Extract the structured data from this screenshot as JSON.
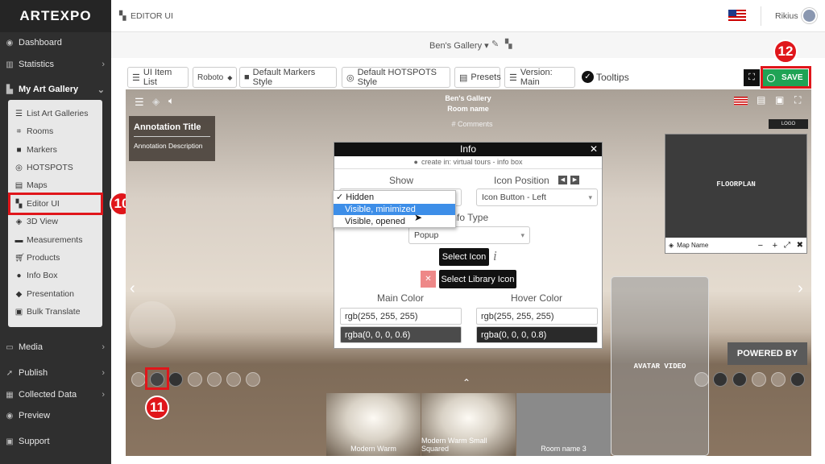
{
  "brand": {
    "logo": "ARTEXPO"
  },
  "sidebar": {
    "items": [
      {
        "label": "Dashboard",
        "icon": "dashboard-icon"
      },
      {
        "label": "Statistics",
        "icon": "statistics-icon"
      },
      {
        "label": "My Art Gallery",
        "icon": "gallery-icon"
      },
      {
        "label": "Media",
        "icon": "media-icon"
      },
      {
        "label": "Publish",
        "icon": "publish-icon"
      },
      {
        "label": "Collected Data",
        "icon": "data-icon"
      },
      {
        "label": "Preview",
        "icon": "eye-icon"
      },
      {
        "label": "Support",
        "icon": "support-icon"
      }
    ],
    "submenu": [
      {
        "label": "List Art Galleries"
      },
      {
        "label": "Rooms"
      },
      {
        "label": "Markers"
      },
      {
        "label": "HOTSPOTS"
      },
      {
        "label": "Maps"
      },
      {
        "label": "Editor UI"
      },
      {
        "label": "3D View"
      },
      {
        "label": "Measurements"
      },
      {
        "label": "Products"
      },
      {
        "label": "Info Box"
      },
      {
        "label": "Presentation"
      },
      {
        "label": "Bulk Translate"
      }
    ]
  },
  "header": {
    "page_title": "EDITOR UI",
    "user": "Rikius",
    "gallery": "Ben's Gallery ▾"
  },
  "toolbar": {
    "ui_item_list": "UI Item List",
    "font": "Roboto",
    "markers_style": "Default Markers Style",
    "hotspots_style": "Default HOTSPOTS Style",
    "presets": "Presets",
    "version": "Version: Main",
    "tooltips": "Tooltips",
    "save": "SAVE"
  },
  "viewer": {
    "gallery_name": "Ben's Gallery",
    "room_name": "Room name",
    "comments": "# Comments",
    "logo": "LOGO",
    "annotation_title": "Annotation Title",
    "annotation_desc": "Annotation Description",
    "floorplan": "FLOORPLAN",
    "map_name": "Map Name",
    "avatar_video": "AVATAR VIDEO",
    "powered_by": "POWERED BY",
    "thumbs": [
      "Modern Warm",
      "Modern Warm Small Squared",
      "Room name 3"
    ]
  },
  "info_dialog": {
    "title": "Info",
    "hint": "create in: virtual tours - info box",
    "show_label": "Show",
    "icon_position_label": "Icon Position",
    "icon_position_value": "Icon Button - Left",
    "info_type_label": "Info Type",
    "info_type_value": "Popup",
    "select_icon": "Select Icon",
    "select_library_icon": "Select Library Icon",
    "main_color_label": "Main Color",
    "hover_color_label": "Hover Color",
    "main_color_1": "rgb(255, 255, 255)",
    "main_color_2": "rgba(0, 0, 0, 0.6)",
    "hover_color_1": "rgb(255, 255, 255)",
    "hover_color_2": "rgba(0, 0, 0, 0.8)",
    "show_options": [
      "✓ Hidden",
      "Visible, minimized",
      "Visible, opened"
    ]
  },
  "annotations": {
    "n10": "10",
    "n11": "11",
    "n12": "12"
  },
  "colors": {
    "accent_red": "#e0161b",
    "save_green": "#1fa355",
    "sidebar_bg": "#2f2f2f",
    "highlight_blue": "#3d8ee8"
  }
}
